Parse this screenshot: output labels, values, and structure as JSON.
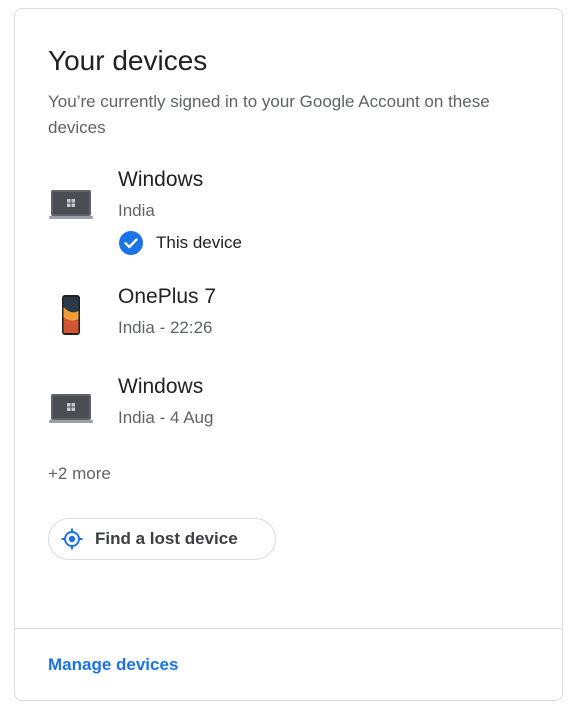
{
  "card": {
    "title": "Your devices",
    "subtitle": "You’re currently signed in to your Google Account on these devices"
  },
  "devices": [
    {
      "name": "Windows",
      "meta": "India",
      "icon": "laptop-icon",
      "this_device_label": "This device",
      "this_device_icon": "check-circle-icon"
    },
    {
      "name": "OnePlus 7",
      "meta": "India - 22:26",
      "icon": "phone-icon"
    },
    {
      "name": "Windows",
      "meta": "India - 4 Aug",
      "icon": "laptop-icon"
    }
  ],
  "more_label": "+2 more",
  "find_button": {
    "label": "Find a lost device",
    "icon": "locate-icon"
  },
  "manage_link": "Manage devices",
  "colors": {
    "accent": "#1a73e8",
    "text_primary": "#202124",
    "text_secondary": "#5f6368",
    "border": "#dadce0"
  }
}
